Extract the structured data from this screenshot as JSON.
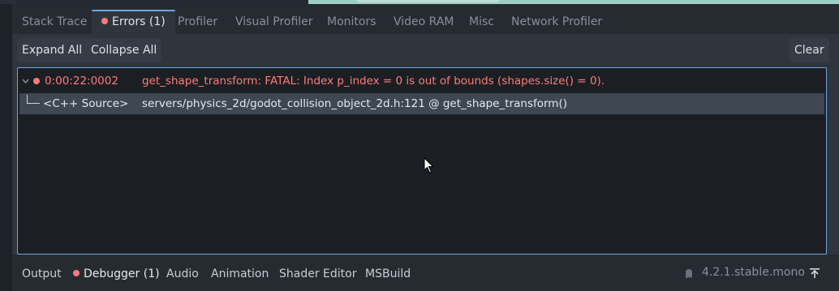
{
  "tabs": [
    {
      "label": "Stack Trace"
    },
    {
      "label": "Errors (1)",
      "active": true
    },
    {
      "label": "Profiler"
    },
    {
      "label": "Visual Profiler"
    },
    {
      "label": "Monitors"
    },
    {
      "label": "Video RAM"
    },
    {
      "label": "Misc"
    },
    {
      "label": "Network Profiler"
    }
  ],
  "toolbar": {
    "expand_all": "Expand All",
    "collapse_all": "Collapse All",
    "clear": "Clear"
  },
  "errors": [
    {
      "time": "0:00:22:0002",
      "message": "get_shape_transform: FATAL: Index p_index = 0 is out of bounds (shapes.size() = 0).",
      "source_label": "<C++ Source>",
      "source_path": "servers/physics_2d/godot_collision_object_2d.h:121 @ get_shape_transform()"
    }
  ],
  "bottom_tabs": [
    {
      "label": "Output"
    },
    {
      "label": "Debugger (1)",
      "active": true
    },
    {
      "label": "Audio"
    },
    {
      "label": "Animation"
    },
    {
      "label": "Shader Editor"
    },
    {
      "label": "MSBuild"
    }
  ],
  "version": "4.2.1.stable.mono",
  "colors": {
    "error": "#ff7b7b",
    "accent": "#6fa5e0",
    "selected_row": "#3f4753"
  },
  "icons": {
    "collapse_arrow": "chevron-down-icon",
    "error_dot": "error-dot-icon",
    "update_spinner": "ghost-icon",
    "pin_panel": "pin-icon"
  }
}
